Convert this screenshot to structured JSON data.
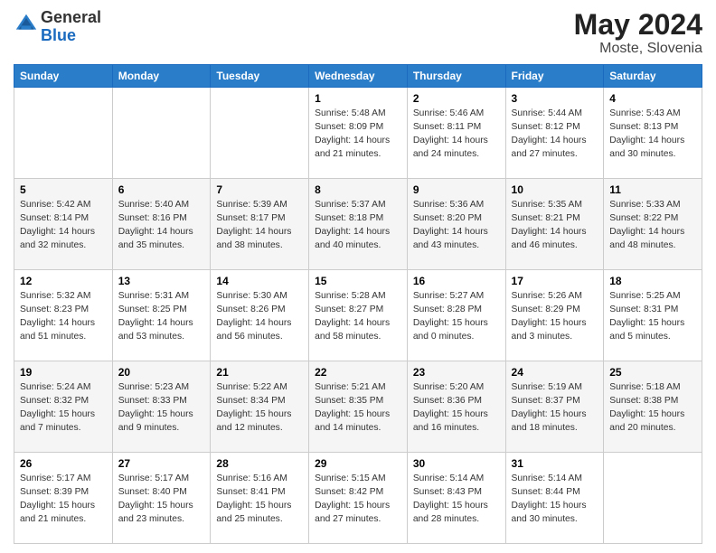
{
  "header": {
    "logo_line1": "General",
    "logo_line2": "Blue",
    "title": "May 2024",
    "location": "Moste, Slovenia"
  },
  "weekdays": [
    "Sunday",
    "Monday",
    "Tuesday",
    "Wednesday",
    "Thursday",
    "Friday",
    "Saturday"
  ],
  "weeks": [
    [
      {
        "day": "",
        "info": ""
      },
      {
        "day": "",
        "info": ""
      },
      {
        "day": "",
        "info": ""
      },
      {
        "day": "1",
        "info": "Sunrise: 5:48 AM\nSunset: 8:09 PM\nDaylight: 14 hours\nand 21 minutes."
      },
      {
        "day": "2",
        "info": "Sunrise: 5:46 AM\nSunset: 8:11 PM\nDaylight: 14 hours\nand 24 minutes."
      },
      {
        "day": "3",
        "info": "Sunrise: 5:44 AM\nSunset: 8:12 PM\nDaylight: 14 hours\nand 27 minutes."
      },
      {
        "day": "4",
        "info": "Sunrise: 5:43 AM\nSunset: 8:13 PM\nDaylight: 14 hours\nand 30 minutes."
      }
    ],
    [
      {
        "day": "5",
        "info": "Sunrise: 5:42 AM\nSunset: 8:14 PM\nDaylight: 14 hours\nand 32 minutes."
      },
      {
        "day": "6",
        "info": "Sunrise: 5:40 AM\nSunset: 8:16 PM\nDaylight: 14 hours\nand 35 minutes."
      },
      {
        "day": "7",
        "info": "Sunrise: 5:39 AM\nSunset: 8:17 PM\nDaylight: 14 hours\nand 38 minutes."
      },
      {
        "day": "8",
        "info": "Sunrise: 5:37 AM\nSunset: 8:18 PM\nDaylight: 14 hours\nand 40 minutes."
      },
      {
        "day": "9",
        "info": "Sunrise: 5:36 AM\nSunset: 8:20 PM\nDaylight: 14 hours\nand 43 minutes."
      },
      {
        "day": "10",
        "info": "Sunrise: 5:35 AM\nSunset: 8:21 PM\nDaylight: 14 hours\nand 46 minutes."
      },
      {
        "day": "11",
        "info": "Sunrise: 5:33 AM\nSunset: 8:22 PM\nDaylight: 14 hours\nand 48 minutes."
      }
    ],
    [
      {
        "day": "12",
        "info": "Sunrise: 5:32 AM\nSunset: 8:23 PM\nDaylight: 14 hours\nand 51 minutes."
      },
      {
        "day": "13",
        "info": "Sunrise: 5:31 AM\nSunset: 8:25 PM\nDaylight: 14 hours\nand 53 minutes."
      },
      {
        "day": "14",
        "info": "Sunrise: 5:30 AM\nSunset: 8:26 PM\nDaylight: 14 hours\nand 56 minutes."
      },
      {
        "day": "15",
        "info": "Sunrise: 5:28 AM\nSunset: 8:27 PM\nDaylight: 14 hours\nand 58 minutes."
      },
      {
        "day": "16",
        "info": "Sunrise: 5:27 AM\nSunset: 8:28 PM\nDaylight: 15 hours\nand 0 minutes."
      },
      {
        "day": "17",
        "info": "Sunrise: 5:26 AM\nSunset: 8:29 PM\nDaylight: 15 hours\nand 3 minutes."
      },
      {
        "day": "18",
        "info": "Sunrise: 5:25 AM\nSunset: 8:31 PM\nDaylight: 15 hours\nand 5 minutes."
      }
    ],
    [
      {
        "day": "19",
        "info": "Sunrise: 5:24 AM\nSunset: 8:32 PM\nDaylight: 15 hours\nand 7 minutes."
      },
      {
        "day": "20",
        "info": "Sunrise: 5:23 AM\nSunset: 8:33 PM\nDaylight: 15 hours\nand 9 minutes."
      },
      {
        "day": "21",
        "info": "Sunrise: 5:22 AM\nSunset: 8:34 PM\nDaylight: 15 hours\nand 12 minutes."
      },
      {
        "day": "22",
        "info": "Sunrise: 5:21 AM\nSunset: 8:35 PM\nDaylight: 15 hours\nand 14 minutes."
      },
      {
        "day": "23",
        "info": "Sunrise: 5:20 AM\nSunset: 8:36 PM\nDaylight: 15 hours\nand 16 minutes."
      },
      {
        "day": "24",
        "info": "Sunrise: 5:19 AM\nSunset: 8:37 PM\nDaylight: 15 hours\nand 18 minutes."
      },
      {
        "day": "25",
        "info": "Sunrise: 5:18 AM\nSunset: 8:38 PM\nDaylight: 15 hours\nand 20 minutes."
      }
    ],
    [
      {
        "day": "26",
        "info": "Sunrise: 5:17 AM\nSunset: 8:39 PM\nDaylight: 15 hours\nand 21 minutes."
      },
      {
        "day": "27",
        "info": "Sunrise: 5:17 AM\nSunset: 8:40 PM\nDaylight: 15 hours\nand 23 minutes."
      },
      {
        "day": "28",
        "info": "Sunrise: 5:16 AM\nSunset: 8:41 PM\nDaylight: 15 hours\nand 25 minutes."
      },
      {
        "day": "29",
        "info": "Sunrise: 5:15 AM\nSunset: 8:42 PM\nDaylight: 15 hours\nand 27 minutes."
      },
      {
        "day": "30",
        "info": "Sunrise: 5:14 AM\nSunset: 8:43 PM\nDaylight: 15 hours\nand 28 minutes."
      },
      {
        "day": "31",
        "info": "Sunrise: 5:14 AM\nSunset: 8:44 PM\nDaylight: 15 hours\nand 30 minutes."
      },
      {
        "day": "",
        "info": ""
      }
    ]
  ]
}
